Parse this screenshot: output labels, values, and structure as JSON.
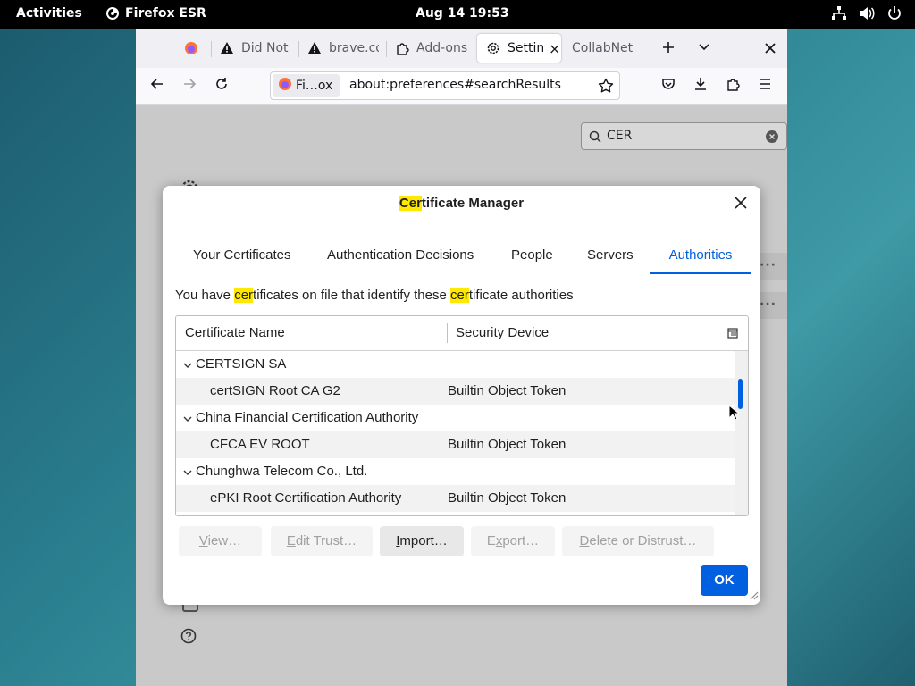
{
  "topbar": {
    "activities": "Activities",
    "app_name": "Firefox ESR",
    "clock": "Aug 14  19:53"
  },
  "browser": {
    "tabs": [
      {
        "label": "",
        "icon": "firefox-icon"
      },
      {
        "label": "Did Not",
        "icon": "warning-icon"
      },
      {
        "label": "brave.co",
        "icon": "warning-icon"
      },
      {
        "label": "Add-ons",
        "icon": "puzzle-icon"
      },
      {
        "label": "Settin",
        "icon": "gear-icon",
        "selected": true
      },
      {
        "label": "CollabNet",
        "icon": ""
      }
    ],
    "identity_label": "Fi…ox",
    "url": "about:preferences#searchResults"
  },
  "page": {
    "search_value": "CER"
  },
  "dialog": {
    "title_hl": "Cer",
    "title_rest": "tificate Manager",
    "tabs": [
      "Your Certificates",
      "Authentication Decisions",
      "People",
      "Servers",
      "Authorities"
    ],
    "desc_1": "You have ",
    "desc_hl1": "cer",
    "desc_2": "tificates on file that identify these ",
    "desc_hl2": "cer",
    "desc_3": "tificate authorities",
    "columns": [
      "Certificate Name",
      "Security Device"
    ],
    "rows": [
      {
        "type": "group",
        "name": "CERTSIGN SA",
        "device": ""
      },
      {
        "type": "item",
        "name": "certSIGN Root CA G2",
        "device": "Builtin Object Token"
      },
      {
        "type": "group",
        "name": "China Financial Certification Authority",
        "device": ""
      },
      {
        "type": "item",
        "name": "CFCA EV ROOT",
        "device": "Builtin Object Token"
      },
      {
        "type": "group",
        "name": "Chunghwa Telecom Co., Ltd.",
        "device": ""
      },
      {
        "type": "item",
        "name": "ePKI Root Certification Authority",
        "device": "Builtin Object Token"
      }
    ],
    "buttons": {
      "view_u": "V",
      "view_rest": "iew…",
      "edit_u": "E",
      "edit_rest": "dit Trust…",
      "import_u": "I",
      "import_rest": "mport…",
      "export_u": "x",
      "export_pre": "E",
      "export_rest": "port…",
      "delete_u": "D",
      "delete_rest": "elete or Distrust…",
      "ok": "OK"
    }
  },
  "colors": {
    "accent": "#0060df",
    "highlight": "#ffe900"
  }
}
